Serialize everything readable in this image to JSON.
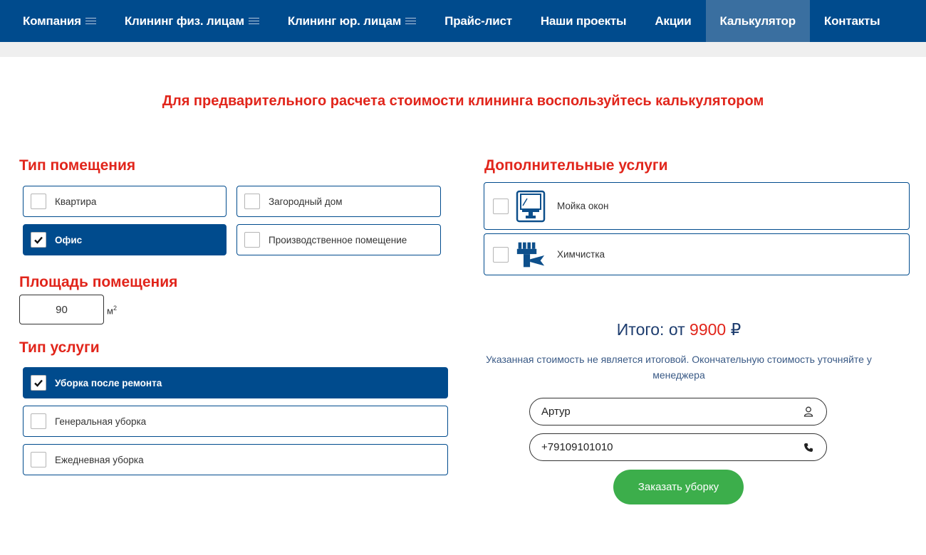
{
  "nav": {
    "items": [
      {
        "label": "Компания",
        "menu": true
      },
      {
        "label": "Клининг физ. лицам",
        "menu": true
      },
      {
        "label": "Клининг юр. лицам",
        "menu": true
      },
      {
        "label": "Прайс-лист",
        "menu": false
      },
      {
        "label": "Наши проекты",
        "menu": false
      },
      {
        "label": "Акции",
        "menu": false
      },
      {
        "label": "Калькулятор",
        "menu": false,
        "active": true
      },
      {
        "label": "Контакты",
        "menu": false
      }
    ]
  },
  "lead": "Для предварительного расчета стоимости клининга воспользуйтесь калькулятором",
  "room_type": {
    "title": "Тип помещения",
    "options": [
      {
        "label": "Квартира",
        "checked": false
      },
      {
        "label": "Загородный дом",
        "checked": false
      },
      {
        "label": "Офис",
        "checked": true
      },
      {
        "label": "Производственное помещение",
        "checked": false
      }
    ]
  },
  "area": {
    "title": "Площадь помещения",
    "value": "90",
    "unit": "м",
    "unit_sup": "2"
  },
  "service_type": {
    "title": "Тип услуги",
    "options": [
      {
        "label": "Уборка после ремонта",
        "checked": true
      },
      {
        "label": "Генеральная уборка",
        "checked": false
      },
      {
        "label": "Ежедневная уборка",
        "checked": false
      }
    ]
  },
  "extras": {
    "title": "Дополнительные услуги",
    "options": [
      {
        "label": "Мойка окон",
        "icon": "window-cleaning-icon",
        "checked": false
      },
      {
        "label": "Химчистка",
        "icon": "dry-cleaning-icon",
        "checked": false
      }
    ]
  },
  "total": {
    "prefix": "Итого: от",
    "price": "9900",
    "currency": "₽",
    "note": "Указанная стоимость не является итоговой. Окончательную стоимость уточняйте у менеджера"
  },
  "form": {
    "name_value": "Артур",
    "phone_value": "+79109101010",
    "submit_label": "Заказать уборку"
  },
  "colors": {
    "brand_blue": "#004b8d",
    "accent_red": "#e1251b",
    "button_green": "#3cae4b"
  }
}
